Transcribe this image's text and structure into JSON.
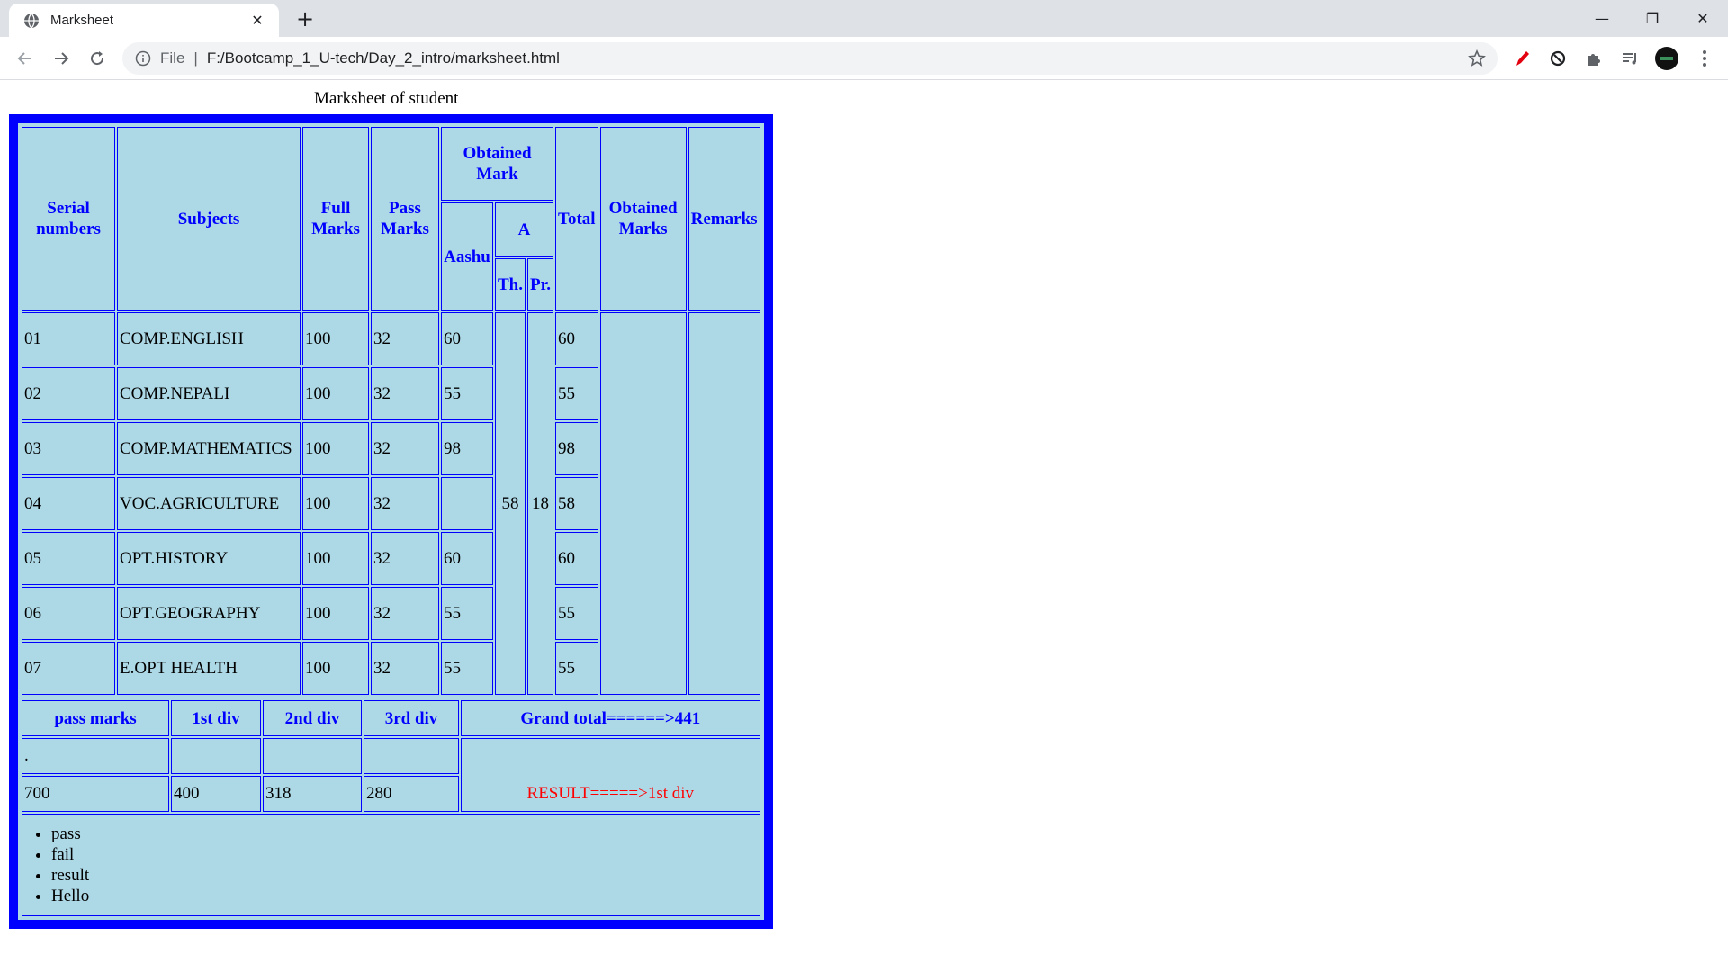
{
  "browser": {
    "tab_title": "Marksheet",
    "address_scheme": "File",
    "address_url": "F:/Bootcamp_1_U-tech/Day_2_intro/marksheet.html"
  },
  "page": {
    "caption": "Marksheet of student",
    "headers": {
      "serial": "Serial numbers",
      "subjects": "Subjects",
      "full_marks": "Full Marks",
      "pass_marks": "Pass Marks",
      "obtained_mark": "Obtained Mark",
      "aashu": "Aashu",
      "a": "A",
      "th": "Th.",
      "pr": "Pr.",
      "total": "Total",
      "obtained_marks": "Obtained Marks",
      "remarks": "Remarks"
    },
    "rows": [
      {
        "serial": "01",
        "subject": "COMP.ENGLISH",
        "full": "100",
        "pass": "32",
        "aashu": "60",
        "total": "60"
      },
      {
        "serial": "02",
        "subject": "COMP.NEPALI",
        "full": "100",
        "pass": "32",
        "aashu": "55",
        "total": "55"
      },
      {
        "serial": "03",
        "subject": "COMP.MATHEMATICS",
        "full": "100",
        "pass": "32",
        "aashu": "98",
        "total": "98"
      },
      {
        "serial": "04",
        "subject": "VOC.AGRICULTURE",
        "full": "100",
        "pass": "32",
        "aashu": "",
        "total": "58"
      },
      {
        "serial": "05",
        "subject": "OPT.HISTORY",
        "full": "100",
        "pass": "32",
        "aashu": "60",
        "total": "60"
      },
      {
        "serial": "06",
        "subject": "OPT.GEOGRAPHY",
        "full": "100",
        "pass": "32",
        "aashu": "55",
        "total": "55"
      },
      {
        "serial": "07",
        "subject": "E.OPT HEALTH",
        "full": "100",
        "pass": "32",
        "aashu": "55",
        "total": "55"
      }
    ],
    "agri_th": "58",
    "agri_pr": "18",
    "summary": {
      "headers": [
        "pass marks",
        "1st div",
        "2nd div",
        "3rd div"
      ],
      "grand_total": "Grand total======>441",
      "blank_row": [
        ".",
        "",
        "",
        ""
      ],
      "values": [
        "700",
        "400",
        "318",
        "280"
      ],
      "result": "RESULT=====>1st div"
    },
    "notes": [
      "pass",
      "fail",
      "result",
      "Hello"
    ]
  },
  "colors": {
    "table_border": "#0000ff",
    "table_bg": "#add8e6",
    "result_text": "#ff0000"
  }
}
